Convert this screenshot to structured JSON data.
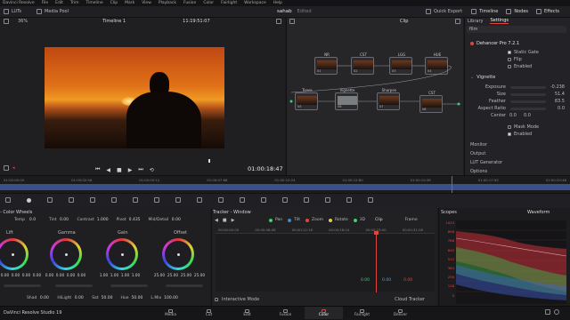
{
  "menu": [
    "Davinci Resolve",
    "File",
    "Edit",
    "Trim",
    "Timeline",
    "Clip",
    "Mark",
    "View",
    "Playback",
    "Fusion",
    "Color",
    "Fairlight",
    "Workspace",
    "Help"
  ],
  "toolbar_left": {
    "luts": "LUTs",
    "media_pool": "Media Pool"
  },
  "project_name": "sahab",
  "project_status": "Edited",
  "toolbar_right": {
    "quick_export": "Quick Export",
    "timeline": "Timeline",
    "nodes": "Nodes",
    "effects": "Effects"
  },
  "viewer": {
    "timeline_name": "Timeline 1",
    "timecode": "11:19:51:07",
    "playhead_time": "01:00:18:47"
  },
  "node_editor": {
    "clip_label": "Clip",
    "nodes": [
      {
        "name": "NR",
        "num": "01"
      },
      {
        "name": "CST",
        "num": "02"
      },
      {
        "name": "LGG",
        "num": "03"
      },
      {
        "name": "HUE",
        "num": "04"
      },
      {
        "name": "Tones",
        "num": "05"
      },
      {
        "name": "Vignette",
        "num": "06"
      },
      {
        "name": "Sharpen",
        "num": "07"
      },
      {
        "name": "CST",
        "num": "08"
      }
    ]
  },
  "inspector": {
    "tabs": [
      "Library",
      "Settings"
    ],
    "search": "film",
    "plugin": "Dehancer Pro 7.2.1",
    "options": [
      "Static Gate",
      "Flip",
      "Enabled"
    ],
    "vignette_title": "Vignette",
    "params": [
      {
        "label": "Exposure",
        "value": "-0.238"
      },
      {
        "label": "Size",
        "value": "51.4"
      },
      {
        "label": "Feather",
        "value": "83.5"
      },
      {
        "label": "Aspect Ratio",
        "value": "0.0"
      },
      {
        "label": "Center",
        "value": "0.0"
      }
    ],
    "center_y": "0.0",
    "mask_mode": "Mask Mode",
    "vignette_enabled": "Enabled",
    "sections": [
      "Monitor",
      "Output",
      "LUT Generator",
      "Options"
    ]
  },
  "timeline_ruler": [
    "01:00:00:00",
    "01:00:02:56",
    "01:00:05:12",
    "01:00:07:68",
    "01:00:10:24",
    "01:00:12:80",
    "01:00:15:36",
    "01:00:17:92",
    "01:00:20:48"
  ],
  "color_wheels": {
    "title": "Color Wheels",
    "top_params": [
      {
        "label": "Temp",
        "value": "0.0"
      },
      {
        "label": "Tint",
        "value": "0.00"
      },
      {
        "label": "Contrast",
        "value": "1.000"
      },
      {
        "label": "Pivot",
        "value": "0.435"
      },
      {
        "label": "Mid/Detail",
        "value": "0.00"
      }
    ],
    "wheels": [
      {
        "name": "Lift",
        "values": [
          "0.00",
          "0.00",
          "0.00",
          "0.00"
        ]
      },
      {
        "name": "Gamma",
        "values": [
          "0.00",
          "0.00",
          "0.00",
          "0.00"
        ]
      },
      {
        "name": "Gain",
        "values": [
          "1.00",
          "1.00",
          "1.00",
          "1.00"
        ]
      },
      {
        "name": "Offset",
        "values": [
          "25.00",
          "25.00",
          "25.00",
          "25.00"
        ]
      }
    ],
    "bottom_params": [
      {
        "label": "Shad",
        "value": "0.00"
      },
      {
        "label": "HiLight",
        "value": "0.00"
      },
      {
        "label": "Sat",
        "value": "50.00"
      },
      {
        "label": "Hue",
        "value": "50.00"
      },
      {
        "label": "L.Mix",
        "value": "100.00"
      }
    ]
  },
  "tracker": {
    "title": "Tracker - Window",
    "toggles": [
      "Pan",
      "Tilt",
      "Zoom",
      "Rotate",
      "3D"
    ],
    "mode": "Clip",
    "frame_label": "Frame",
    "ruler": [
      "00:00:00:00",
      "00:00:06:08",
      "00:00:12:16",
      "00:00:18:24",
      "00:00:25:00",
      "00:00:31:08"
    ],
    "values": [
      "0.00",
      "0.00",
      "0.00"
    ],
    "interactive_mode": "Interactive Mode",
    "cloud_tracker": "Cloud Tracker"
  },
  "scopes": {
    "title": "Scopes",
    "mode": "Waveform",
    "scale": [
      "1023",
      "896",
      "768",
      "640",
      "512",
      "384",
      "256",
      "128",
      "0"
    ]
  },
  "pages": [
    "Media",
    "Cut",
    "Edit",
    "Fusion",
    "Color",
    "Fairlight",
    "Deliver"
  ],
  "active_page": "Color",
  "app_footer": "DaVinci Resolve Studio 19",
  "colors": {
    "accent_red": "#e0463e",
    "bg": "#1c1c1f",
    "panel": "#232327"
  }
}
